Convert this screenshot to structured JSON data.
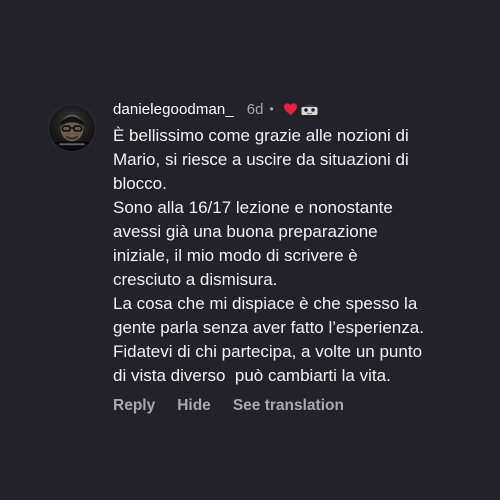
{
  "comment": {
    "username": "danielegoodman_",
    "timestamp": "6d",
    "separator": "•",
    "avatar_icon": "profile-photo",
    "liked_by_author_icons": [
      "heart-icon",
      "author-avatar-icon"
    ],
    "heart_color": "#e8203c",
    "lines": [
      "È bellissimo come grazie alle nozioni di",
      "Mario, si riesce a uscire da situazioni di",
      "blocco.",
      "Sono alla 16/17 lezione e nonostante",
      "avessi già una buona preparazione",
      "iniziale, il mio modo di scrivere è",
      "cresciuto a dismisura.",
      "La cosa che mi dispiace è che spesso la",
      "gente parla senza aver fatto l’esperienza.",
      "Fidatevi di chi partecipa, a volte un punto",
      "di vista diverso  può cambiarti la vita."
    ]
  },
  "actions": {
    "reply": "Reply",
    "hide": "Hide",
    "see_translation": "See translation"
  }
}
